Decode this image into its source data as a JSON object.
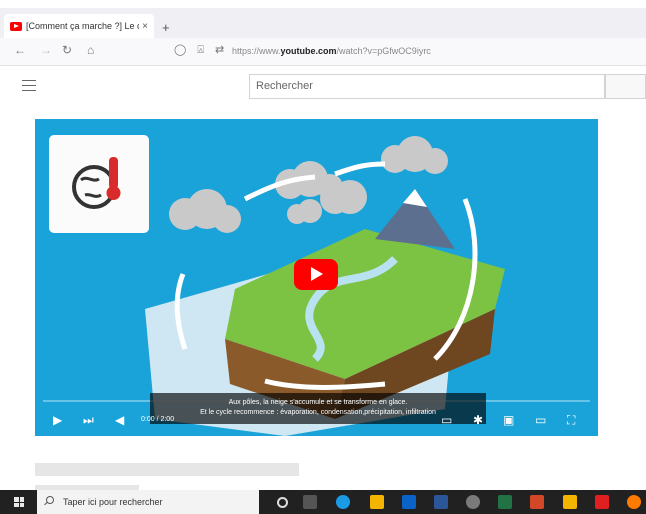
{
  "browser": {
    "tab_title": "[Comment ça marche ?] Le cycl",
    "tab_close": "×",
    "new_tab": "+",
    "url_prefix": "https://www.",
    "url_domain": "youtube.com",
    "url_suffix": "/watch?v=pGfwOC9iyrc"
  },
  "youtube": {
    "search_placeholder": "Rechercher"
  },
  "video": {
    "subtitle_line1": "Aux pôles, la neige s'accumule et se transforme en glace.",
    "subtitle_line2": "Et le cycle recommence : évaporation, condensation,précipitation, infiltration",
    "time": "0:00 / 2:00",
    "progress": 0.0
  },
  "taskbar": {
    "search_placeholder": "Taper ici pour rechercher"
  },
  "colors": {
    "video_bg": "#1aa3d9",
    "youtube_red": "#ff0000",
    "taskbar": "#212121"
  }
}
